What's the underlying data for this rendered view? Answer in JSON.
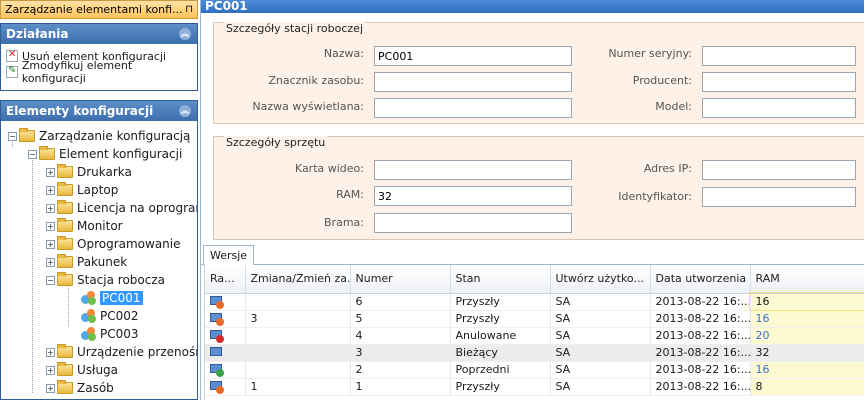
{
  "doc_tab": {
    "title": "Zarządzanie elementami konfi...",
    "pin": "⊓"
  },
  "actions_panel": {
    "title": "Działania",
    "items": [
      {
        "label": "Usuń element konfiguracji",
        "icon": "delete-icon"
      },
      {
        "label": "Zmodyfikuj element konfiguracji",
        "icon": "edit-icon"
      }
    ]
  },
  "elements_panel": {
    "title": "Elementy konfiguracji",
    "tree": {
      "root": "Zarządzanie konfiguracją",
      "level1": "Element konfiguracji",
      "children": [
        "Drukarka",
        "Laptop",
        "Licencja na oprogram",
        "Monitor",
        "Oprogramowanie",
        "Pakunek",
        "Stacja robocza",
        "Urządzenie przenośne",
        "Usługa",
        "Zasób"
      ],
      "workstations": [
        "PC001",
        "PC002",
        "PC003"
      ],
      "selected": "PC001"
    }
  },
  "main": {
    "title": "PC001",
    "station_group": {
      "title": "Szczegóły stacji roboczej",
      "labels": {
        "name": "Nazwa:",
        "asset_tag": "Znacznik zasobu:",
        "display_name": "Nazwa wyświetlana:",
        "serial": "Numer seryjny:",
        "producer": "Producent:",
        "model": "Model:"
      },
      "values": {
        "name": "PC001",
        "asset_tag": "",
        "display_name": "",
        "serial": "",
        "producer": "",
        "model": ""
      }
    },
    "hardware_group": {
      "title": "Szczegóły sprzętu",
      "labels": {
        "video_card": "Karta wideo:",
        "ram": "RAM:",
        "gateway": "Brama:",
        "ip": "Adres IP:",
        "identifier": "Identyfikator:"
      },
      "values": {
        "video_card": "",
        "ram": "32",
        "gateway": "",
        "ip": "",
        "identifier": ""
      }
    },
    "versions_tab": {
      "label": "Wersje"
    },
    "grid": {
      "columns": [
        "Ra...",
        "Zmiana/Zmień za...",
        "Numer",
        "Stan",
        "Utwórz użytko...",
        "Data utworzenia",
        "RAM"
      ],
      "rows": [
        {
          "change": "",
          "number": "6",
          "state": "Przyszły",
          "user": "SA",
          "date": "2013-08-22 16:...",
          "ram": "16",
          "icon_color": "#e56b2b"
        },
        {
          "change": "3",
          "number": "5",
          "state": "Przyszły",
          "user": "SA",
          "date": "2013-08-22 16:...",
          "ram": "16",
          "icon_color": "#e56b2b"
        },
        {
          "change": "",
          "number": "4",
          "state": "Anulowane",
          "user": "SA",
          "date": "2013-08-22 16:...",
          "ram": "20",
          "icon_color": "#d62a2a"
        },
        {
          "change": "",
          "number": "3",
          "state": "Bieżący",
          "user": "SA",
          "date": "2013-08-22 16:...",
          "ram": "32",
          "icon_color": "#5b8fd2"
        },
        {
          "change": "",
          "number": "2",
          "state": "Poprzedni",
          "user": "SA",
          "date": "2013-08-22 16:...",
          "ram": "16",
          "icon_color": "#3aa04a"
        },
        {
          "change": "1",
          "number": "1",
          "state": "Przyszły",
          "user": "SA",
          "date": "2013-08-22 16:...",
          "ram": "8",
          "icon_color": "#e56b2b"
        }
      ]
    }
  },
  "colors": {
    "accent": "#3d6fae",
    "selection": "#3399ff",
    "group_bg": "#fdf1e8",
    "ram_cell": "#fdf9d2"
  }
}
